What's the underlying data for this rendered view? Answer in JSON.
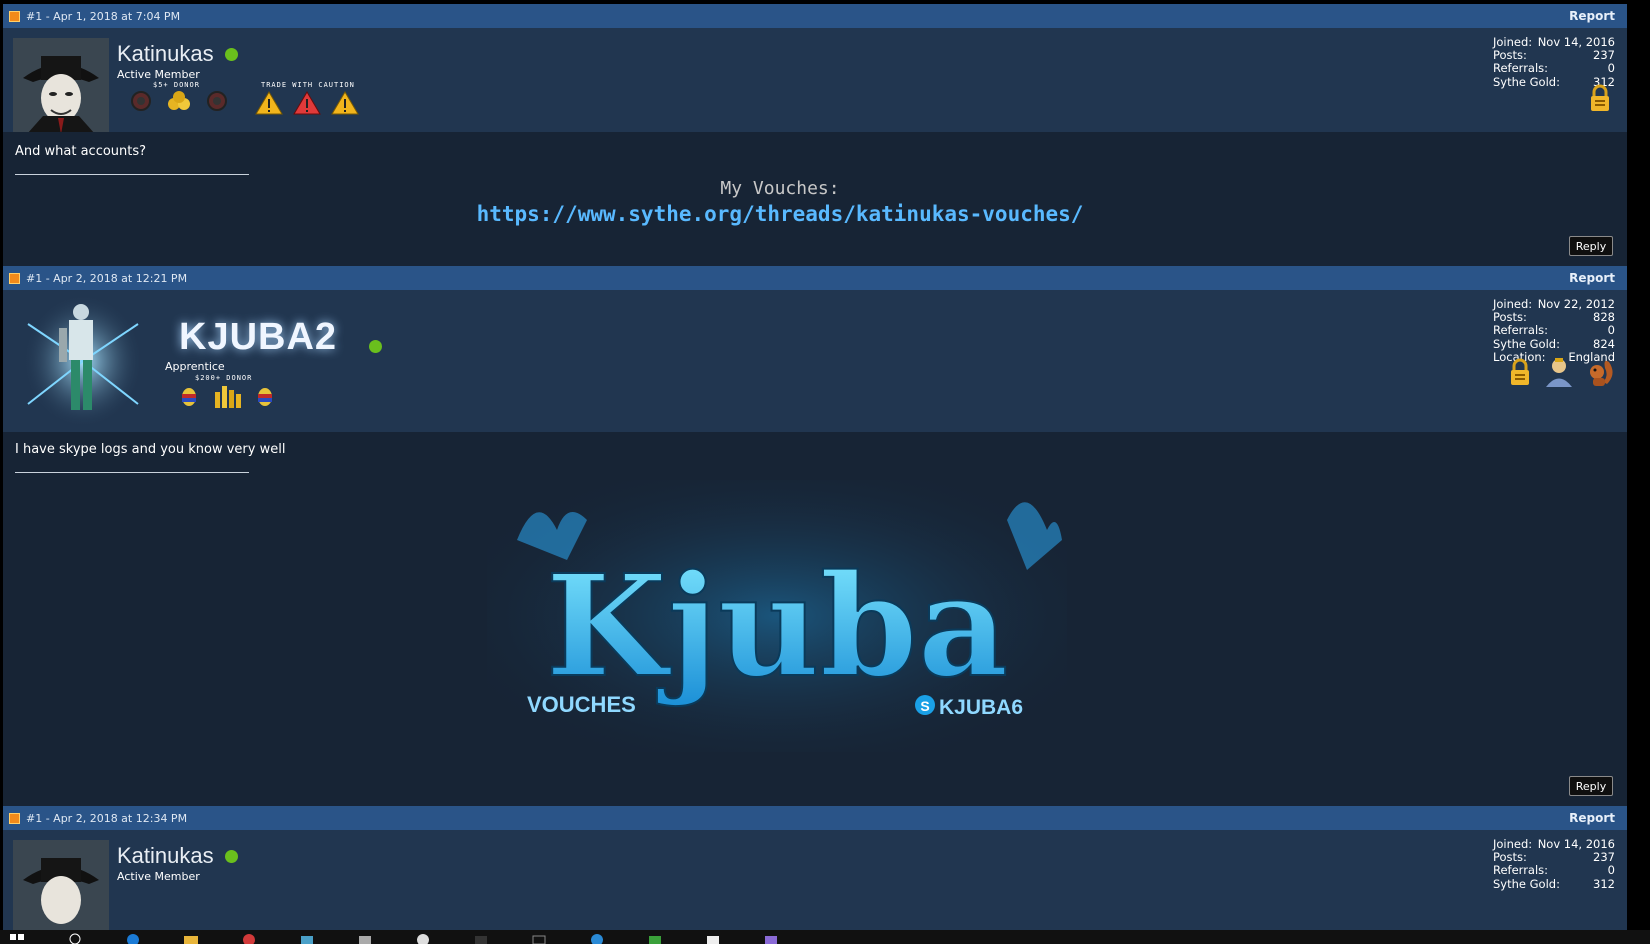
{
  "posts": [
    {
      "header": {
        "meta": "#1 - Apr 1, 2018 at 7:04 PM",
        "report": "Report"
      },
      "username": "Katinukas",
      "usertitle": "Active Member",
      "award_labels": [
        "$5+ DONOR",
        "TRADE WITH CAUTION"
      ],
      "stats": [
        {
          "k": "Joined:",
          "v": "Nov 14, 2016"
        },
        {
          "k": "Posts:",
          "v": "237"
        },
        {
          "k": "Referrals:",
          "v": "0"
        },
        {
          "k": "Sythe Gold:",
          "v": "312"
        }
      ],
      "message": "And what accounts?",
      "signature": {
        "title": "My Vouches:",
        "link": "https://www.sythe.org/threads/katinukas-vouches/"
      },
      "reply": "Reply"
    },
    {
      "header": {
        "meta": "#1 - Apr 2, 2018 at 12:21 PM",
        "report": "Report"
      },
      "username": "KJUBA2",
      "usertitle": "Apprentice",
      "award_labels": [
        "$200+ DONOR"
      ],
      "stats": [
        {
          "k": "Joined:",
          "v": "Nov 22, 2012"
        },
        {
          "k": "Posts:",
          "v": "828"
        },
        {
          "k": "Referrals:",
          "v": "0"
        },
        {
          "k": "Sythe Gold:",
          "v": "824"
        },
        {
          "k": "Location:",
          "v": "England"
        }
      ],
      "message": "I have skype logs and you know very well",
      "banner": {
        "main": "Kjuba",
        "left": "VOUCHES",
        "right": "KJUBA6"
      },
      "reply": "Reply"
    },
    {
      "header": {
        "meta": "#1 - Apr 2, 2018 at 12:34 PM",
        "report": "Report"
      },
      "username": "Katinukas",
      "usertitle": "Active Member",
      "stats": [
        {
          "k": "Joined:",
          "v": "Nov 14, 2016"
        },
        {
          "k": "Posts:",
          "v": "237"
        },
        {
          "k": "Referrals:",
          "v": "0"
        },
        {
          "k": "Sythe Gold:",
          "v": "312"
        }
      ]
    }
  ],
  "colors": {
    "header": "#2a5488",
    "userbar": "#213650",
    "body": "#172435",
    "online": "#6abf1d",
    "link": "#59b9ff"
  }
}
